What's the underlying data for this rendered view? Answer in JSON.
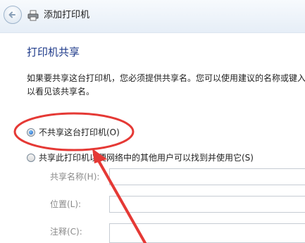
{
  "window": {
    "title": "添加打印机"
  },
  "page": {
    "heading": "打印机共享",
    "description_lines": [
      "如果要共享这台打印机，您必须提供共享名。您可以使用建议的名称或键入",
      "以看见该共享名。"
    ]
  },
  "options": [
    {
      "label": "不共享这台打印机(O)",
      "selected": true
    },
    {
      "label": "共享此打印机以便网络中的其他用户可以找到并使用它(S)",
      "selected": false
    }
  ],
  "fields": {
    "share_name": {
      "label": "共享名称(H):",
      "value": ""
    },
    "location": {
      "label": "位置(L):",
      "value": ""
    },
    "comment": {
      "label": "注释(C):",
      "value": ""
    }
  },
  "annotation": {
    "color": "#e53935",
    "shape": "ellipse-and-arrow"
  }
}
